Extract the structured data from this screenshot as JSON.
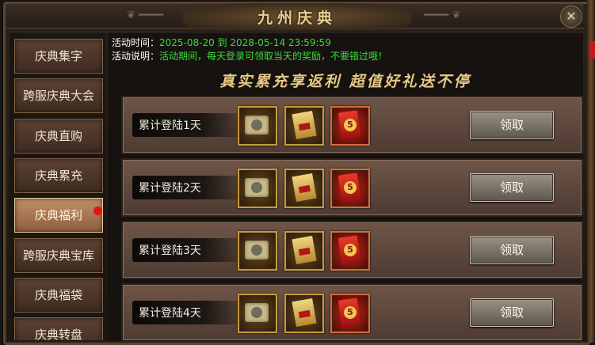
{
  "window": {
    "title": "九州庆典",
    "close_glyph": "✕"
  },
  "sidebar": {
    "items": [
      {
        "label": "庆典集字",
        "active": false,
        "badge": false
      },
      {
        "label": "跨服庆典大会",
        "active": false,
        "badge": false
      },
      {
        "label": "庆典直购",
        "active": false,
        "badge": false
      },
      {
        "label": "庆典累充",
        "active": false,
        "badge": false
      },
      {
        "label": "庆典福利",
        "active": true,
        "badge": true
      },
      {
        "label": "跨服庆典宝库",
        "active": false,
        "badge": false
      },
      {
        "label": "庆典福袋",
        "active": false,
        "badge": false
      },
      {
        "label": "庆典转盘",
        "active": false,
        "badge": false
      }
    ]
  },
  "event": {
    "time_label": "活动时间：",
    "time_value": "2025-08-20 到 2028-05-14 23:59:59",
    "desc_label": "活动说明：",
    "desc_value": "活动期间，每天登录可领取当天的奖励，不要错过哦！",
    "slogan": "真实累充享返利 超值好礼送不停"
  },
  "rewards": [
    {
      "label": "累计登陆1天",
      "button": "领取"
    },
    {
      "label": "累计登陆2天",
      "button": "领取"
    },
    {
      "label": "累计登陆3天",
      "button": "领取"
    },
    {
      "label": "累计登陆4天",
      "button": "领取"
    }
  ],
  "reward_items": [
    {
      "icon": "scroll-icon"
    },
    {
      "icon": "golden-book-icon"
    },
    {
      "icon": "red-envelope-icon",
      "value": "5"
    }
  ],
  "colors": {
    "info_value": "#3cdc3c",
    "title": "#e8cf96",
    "badge": "#e01414",
    "active_tab": "#c08f66"
  }
}
